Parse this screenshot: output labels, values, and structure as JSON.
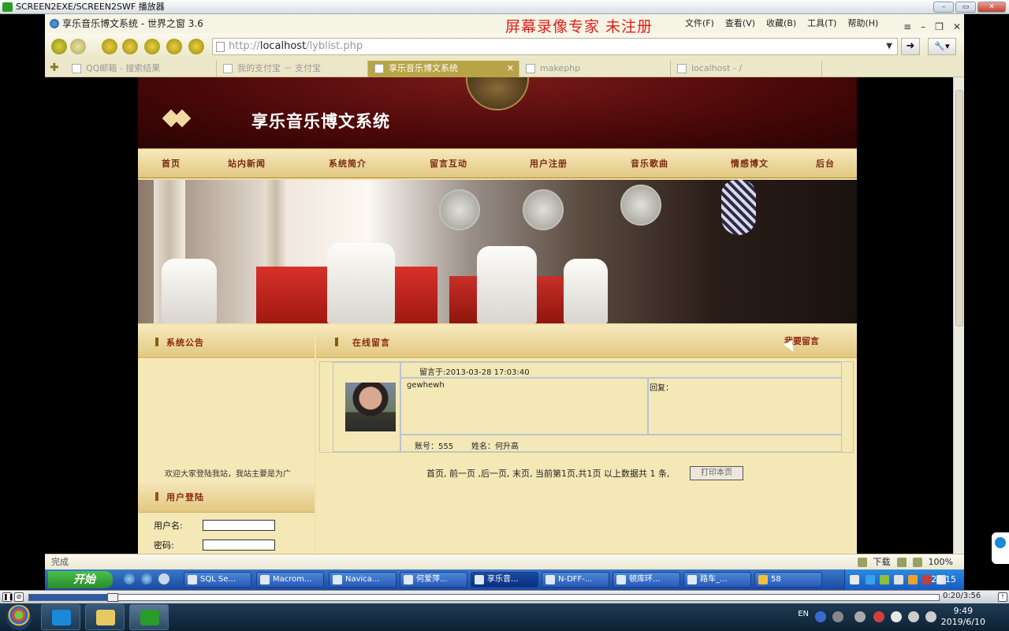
{
  "player": {
    "title": "SCREEN2EXE/SCREEN2SWF 播放器",
    "time": "0:20/3:56"
  },
  "browser": {
    "title": "享乐音乐博文系统 - 世界之窗 3.6",
    "watermark": "屏幕录像专家  未注册",
    "menu": [
      "文件(F)",
      "查看(V)",
      "收藏(B)",
      "工具(T)",
      "帮助(H)"
    ],
    "address": {
      "prefix": "http://",
      "host": "localhost",
      "path": "/lyblist.php"
    },
    "tabs": [
      {
        "label": "QQ邮箱 - 搜索结果",
        "active": false
      },
      {
        "label": "我的支付宝 － 支付宝",
        "active": false
      },
      {
        "label": "享乐音乐博文系统",
        "active": true
      },
      {
        "label": "makephp",
        "active": false
      },
      {
        "label": "localhost - /",
        "active": false
      }
    ],
    "status": "完成",
    "status_download": "下载",
    "zoom": "100%"
  },
  "site": {
    "title": "享乐音乐博文系统",
    "nav": [
      "首页",
      "站内新闻",
      "系统简介",
      "留言互动",
      "用户注册",
      "音乐歌曲",
      "情感博文",
      "后台"
    ],
    "notice_head": "系统公告",
    "notice_text": "欢迎大家登陆我站，我站主要是为广",
    "login_head": "用户登陆",
    "login_user_label": "用户名:",
    "login_pass_label": "密码:",
    "main_head": "在线留言",
    "leave_msg_link": "我要留言",
    "message": {
      "time": "留言于:2013-03-28 17:03:40",
      "content": "gewhewh",
      "reply_label": "回复：",
      "account": "账号：555",
      "name": "姓名：何升高"
    },
    "pager": "首页, 前一页 ,后一页, 末页, 当前第1页,共1页  以上数据共 1 条,",
    "print_button": "打印本页"
  },
  "taskbar": {
    "start": "开始",
    "tasks": [
      "SQL Se...",
      "Macrom...",
      "Navica...",
      "何爱萍...",
      "享乐音...",
      "N-DFF-...",
      "顿库环...",
      "路车_...",
      "58"
    ],
    "clock": "20:15"
  },
  "host": {
    "lang": "EN",
    "time": "9:49",
    "date": "2019/6/10"
  }
}
